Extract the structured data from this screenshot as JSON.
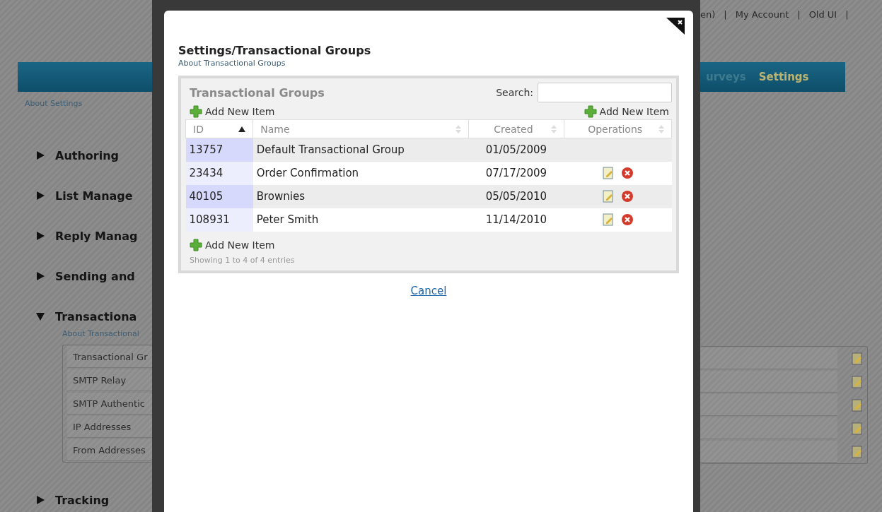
{
  "background_page": {
    "top_links": [
      "en)",
      "|",
      "My Account",
      "|",
      "Old UI",
      "|"
    ],
    "nav": [
      {
        "label": "urveys",
        "selected": false
      },
      {
        "label": "Settings",
        "selected": true
      }
    ],
    "about_link": "About Settings",
    "sections": [
      {
        "title": "Authoring",
        "expanded": false
      },
      {
        "title": "List Manage",
        "expanded": false
      },
      {
        "title": "Reply Manag",
        "expanded": false
      },
      {
        "title": "Sending and",
        "expanded": false
      },
      {
        "title": "Transactiona",
        "expanded": true,
        "about_link": "About Transactional",
        "items": [
          "Transactional Gr",
          "SMTP Relay",
          "SMTP Authentic",
          "IP Addresses",
          "From Addresses"
        ]
      },
      {
        "title": "Tracking",
        "expanded": false
      }
    ]
  },
  "dialog": {
    "title": "Settings/Transactional Groups",
    "about_link": "About Transactional Groups",
    "panel_title": "Transactional Groups",
    "search_label": "Search:",
    "add_top_left": "Add New Item",
    "add_top_right": "Add New Item",
    "add_bottom": "Add New Item",
    "columns": [
      {
        "label": "ID",
        "sorted": true
      },
      {
        "label": "Name",
        "sorted": false
      },
      {
        "label": "Created",
        "sorted": false
      },
      {
        "label": "Operations",
        "sorted": false
      }
    ],
    "rows": [
      {
        "id": "13757",
        "name": "Default Transactional Group",
        "created": "01/05/2009",
        "editable": false
      },
      {
        "id": "23434",
        "name": "Order Confirmation",
        "created": "07/17/2009",
        "editable": true
      },
      {
        "id": "40105",
        "name": "Brownies",
        "created": "05/05/2010",
        "editable": true
      },
      {
        "id": "108931",
        "name": "Peter Smith",
        "created": "11/14/2010",
        "editable": true
      }
    ],
    "info": "Showing 1 to 4 of 4 entries",
    "cancel": "Cancel"
  }
}
